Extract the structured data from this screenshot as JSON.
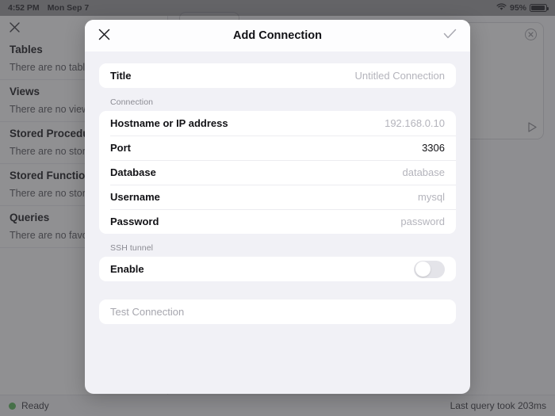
{
  "statusbar": {
    "time": "4:52 PM",
    "date": "Mon Sep 7",
    "wifi_icon": "wifi-icon",
    "battery_percent": "95%",
    "battery_icon": "battery-icon"
  },
  "background": {
    "sidebar": {
      "close_icon": "close-icon",
      "sections": [
        {
          "title": "Tables",
          "empty": "There are no tables"
        },
        {
          "title": "Views",
          "empty": "There are no views"
        },
        {
          "title": "Stored Procedures",
          "empty": "There are no stored procedures"
        },
        {
          "title": "Stored Functions",
          "empty": "There are no stored functions"
        },
        {
          "title": "Queries",
          "empty": "There are no favorites"
        }
      ]
    },
    "editor": {
      "close_icon": "circle-close-icon",
      "run_icon": "run-icon"
    },
    "statusbar_bottom": {
      "status_text": "Ready",
      "status_color": "#5cb85c",
      "query_time": "Last query took 203ms"
    }
  },
  "modal": {
    "close_icon": "close-icon",
    "title": "Add Connection",
    "confirm_icon": "checkmark-icon",
    "title_section": {
      "label": "Title",
      "value": "",
      "placeholder": "Untitled Connection"
    },
    "connection_group": {
      "heading": "Connection",
      "fields": [
        {
          "label": "Hostname or IP address",
          "value": "",
          "placeholder": "192.168.0.10",
          "is_placeholder": true
        },
        {
          "label": "Port",
          "value": "3306",
          "placeholder": "3306",
          "is_placeholder": false
        },
        {
          "label": "Database",
          "value": "",
          "placeholder": "database",
          "is_placeholder": true
        },
        {
          "label": "Username",
          "value": "",
          "placeholder": "mysql",
          "is_placeholder": true
        },
        {
          "label": "Password",
          "value": "",
          "placeholder": "password",
          "is_placeholder": true
        }
      ]
    },
    "ssh_group": {
      "heading": "SSH tunnel",
      "enable_label": "Enable",
      "enable_on": false
    },
    "test_button": {
      "label": "Test Connection"
    }
  }
}
